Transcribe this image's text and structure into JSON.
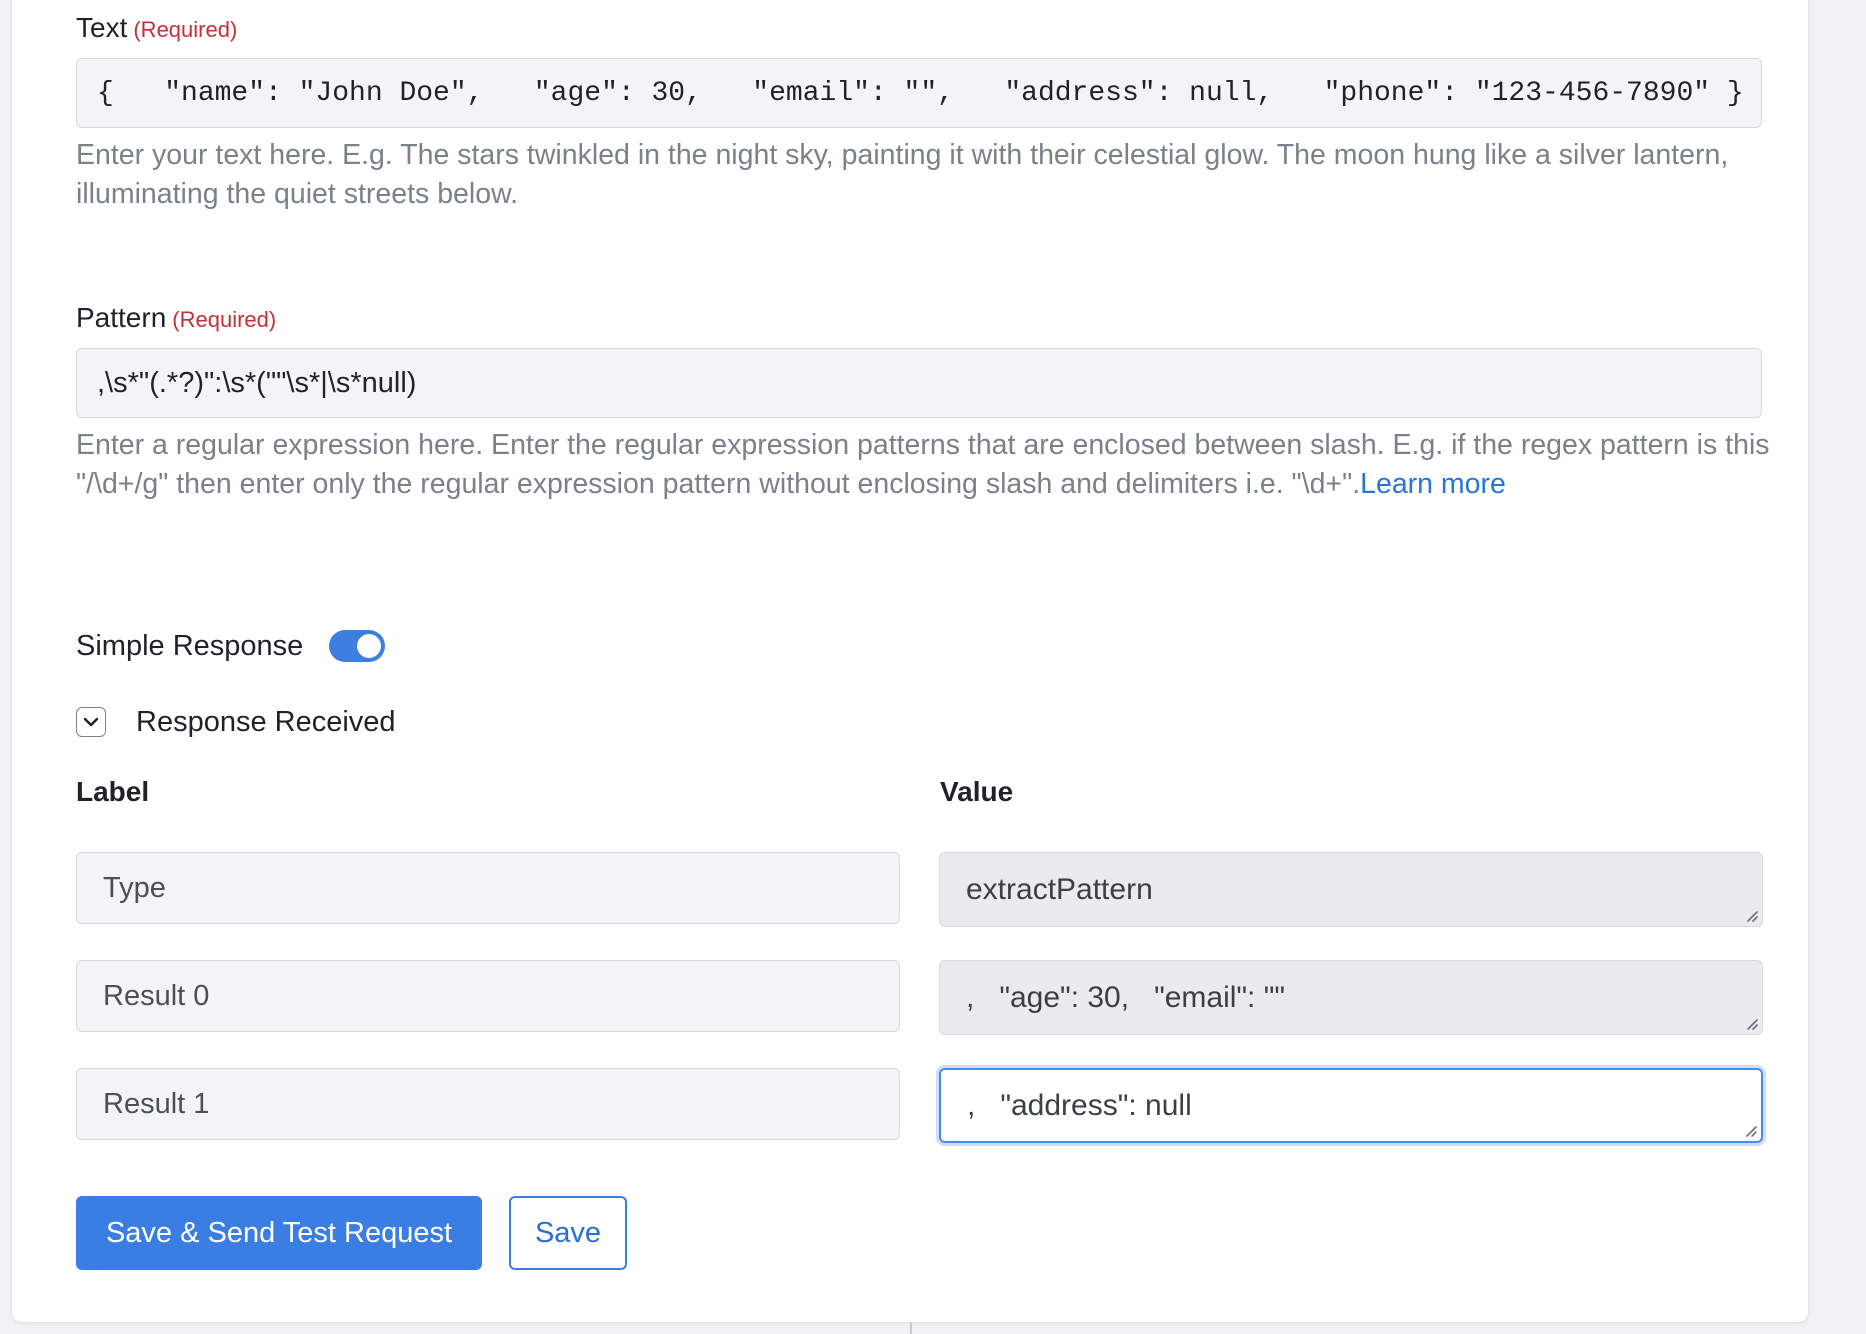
{
  "text_field": {
    "label": "Text",
    "required": "(Required)",
    "value": "{   \"name\": \"John Doe\",   \"age\": 30,   \"email\": \"\",   \"address\": null,   \"phone\": \"123-456-7890\" }",
    "help": "Enter your text here. E.g. The stars twinkled in the night sky, painting it with their celestial glow. The moon hung like a silver lantern, illuminating the quiet streets below."
  },
  "pattern_field": {
    "label": "Pattern",
    "required": "(Required)",
    "value": ",\\s*\"(.*?)\":\\s*(\"\"\\s*|\\s*null)",
    "help": "Enter a regular expression here. Enter the regular expression patterns that are enclosed between slash. E.g. if the regex pattern is this \"/\\d+/g\" then enter only the regular expression pattern without enclosing slash and delimiters i.e. \"\\d+\".",
    "learn_more": "Learn more"
  },
  "simple_response": {
    "label": "Simple Response",
    "enabled": true
  },
  "response_received": {
    "label": "Response Received",
    "icon": "chevron-down-icon",
    "expanded": true
  },
  "columns": {
    "label": "Label",
    "value": "Value"
  },
  "rows": [
    {
      "label": "Type",
      "value": "extractPattern"
    },
    {
      "label": "Result 0",
      "value": ",   \"age\": 30,   \"email\": \"\""
    },
    {
      "label": "Result 1",
      "value": ",   \"address\": null"
    }
  ],
  "buttons": {
    "save_send": "Save & Send Test Request",
    "save": "Save"
  },
  "colors": {
    "primary": "#3a7de3",
    "required": "#c4303a",
    "link": "#2a74d9",
    "help_text": "#7a818b"
  }
}
